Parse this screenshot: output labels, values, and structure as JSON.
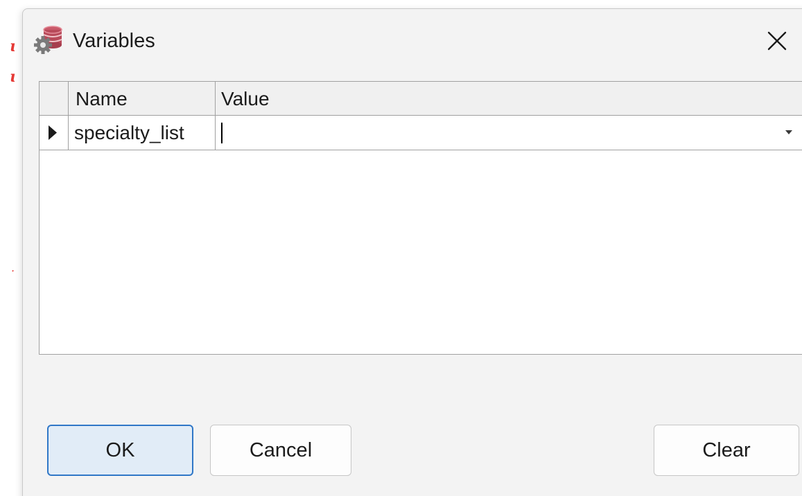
{
  "dialog": {
    "title": "Variables",
    "icon": "database-gear-icon",
    "close_icon": "close-icon"
  },
  "grid": {
    "columns": [
      "Name",
      "Value"
    ],
    "rows": [
      {
        "name": "specialty_list",
        "value": ""
      }
    ]
  },
  "buttons": {
    "ok": "OK",
    "cancel": "Cancel",
    "clear": "Clear"
  },
  "colors": {
    "accent": "#2f77c7",
    "primary_button_bg": "#e1ecf7",
    "database_icon": "#b84a5a"
  }
}
